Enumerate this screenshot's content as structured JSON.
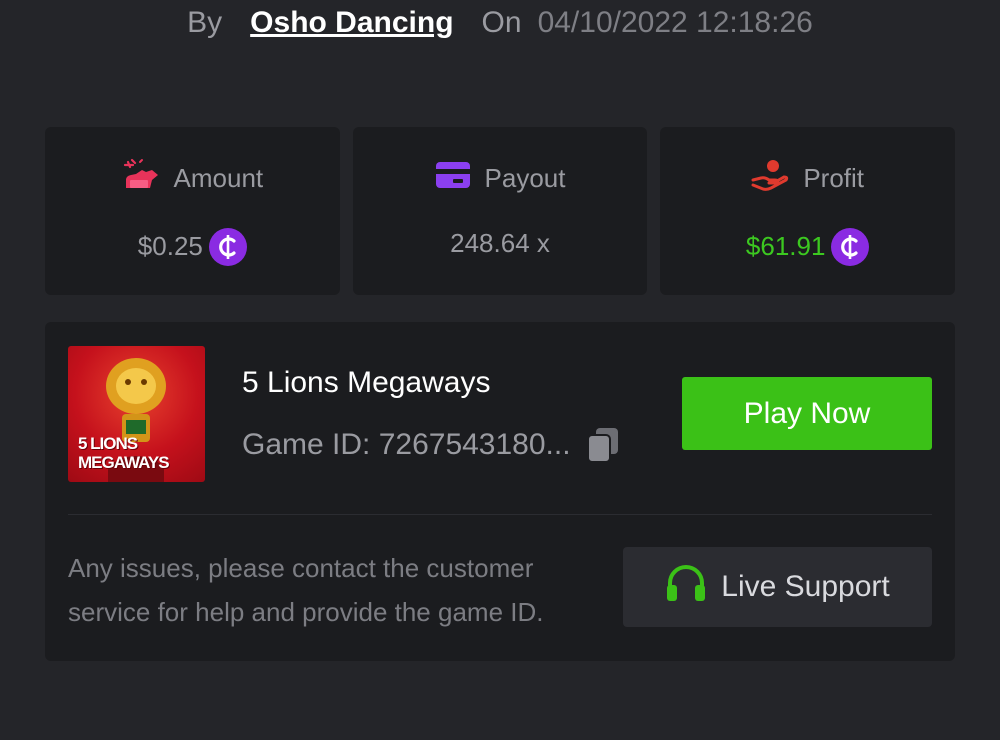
{
  "byline": {
    "by_label": "By",
    "user": "Osho Dancing",
    "on_label": "On",
    "datetime": "04/10/2022 12:18:26"
  },
  "stats": {
    "amount": {
      "label": "Amount",
      "value": "$0.25",
      "icon": "bet-chips-icon",
      "color": "#e8335a"
    },
    "payout": {
      "label": "Payout",
      "value": "248.64 x",
      "icon": "card-icon",
      "color": "#8b3ff0"
    },
    "profit": {
      "label": "Profit",
      "value": "$61.91",
      "icon": "hand-coin-icon",
      "color": "#e03a2e",
      "value_color": "#3cc820"
    },
    "coin_symbol": "₵",
    "coin_color": "#8a2be2"
  },
  "game": {
    "title": "5 Lions Megaways",
    "game_id": "Game ID: 7267543180...",
    "thumb_line1": "5 LIONS",
    "thumb_line2": "MEGAWAYS",
    "play_label": "Play Now",
    "play_color": "#3bc117"
  },
  "support": {
    "help_text": "Any issues, please contact the customer service for help and provide the game ID.",
    "button_label": "Live Support",
    "icon": "headset-icon",
    "icon_color": "#3bc117"
  }
}
